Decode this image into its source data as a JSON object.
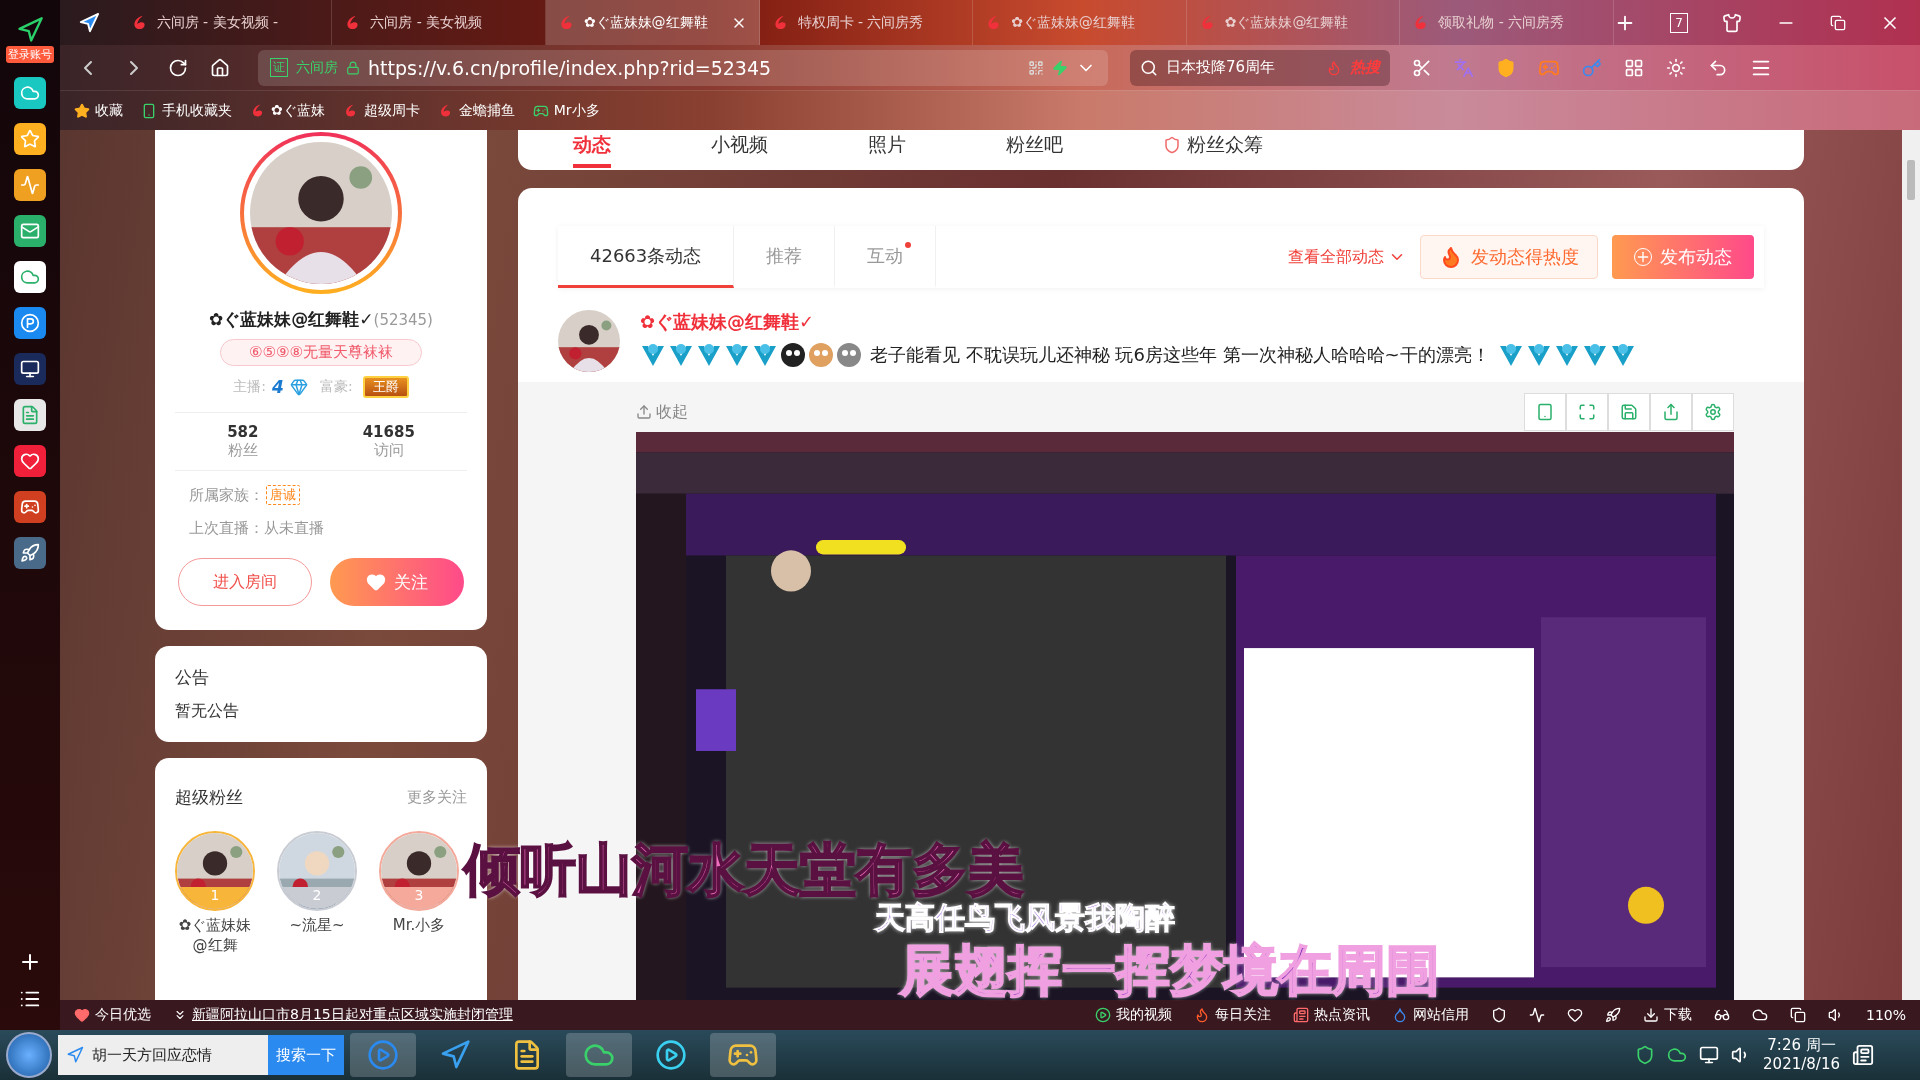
{
  "dock": {
    "login_badge": "登录账号"
  },
  "tabs": [
    {
      "title": "六间房 - 美女视频 -",
      "selected": false
    },
    {
      "title": "六间房 - 美女视频",
      "selected": false
    },
    {
      "title": "✿ぐ蓝妹妹@红舞鞋",
      "selected": true
    },
    {
      "title": "特权周卡 - 六间房秀",
      "selected": false
    },
    {
      "title": "✿ぐ蓝妹妹@红舞鞋",
      "selected": false
    },
    {
      "title": "✿ぐ蓝妹妹@红舞鞋",
      "selected": false
    },
    {
      "title": "领取礼物 - 六间房秀",
      "selected": false
    }
  ],
  "window_count": "7",
  "address": {
    "cert": "证",
    "site": "六间房",
    "url": "https://v.6.cn/profile/index.php?rid=52345"
  },
  "search": {
    "value": "日本投降76周年",
    "hot": "热搜"
  },
  "bookmarks": [
    {
      "kind": "star",
      "label": "收藏"
    },
    {
      "kind": "phone",
      "label": "手机收藏夹"
    },
    {
      "kind": "six",
      "label": "✿ぐ蓝妹"
    },
    {
      "kind": "six",
      "label": "超级周卡"
    },
    {
      "kind": "six",
      "label": "金蟾捕鱼"
    },
    {
      "kind": "app",
      "label": "Mr小多"
    }
  ],
  "nav_tabs": [
    {
      "label": "动态",
      "selected": true
    },
    {
      "label": "小视频",
      "selected": false
    },
    {
      "label": "照片",
      "selected": false
    },
    {
      "label": "粉丝吧",
      "selected": false
    },
    {
      "label": "粉丝众筹",
      "selected": false
    }
  ],
  "profile": {
    "name": "✿ぐ蓝妹妹@红舞鞋✓",
    "rid": "(52345)",
    "title_badge": "⑥⑤⑨⑧无量天尊袜袜",
    "anchor_label": "主播:",
    "anchor_level": "4",
    "rich_label": "富豪:",
    "rich_badge": "王爵",
    "stats": [
      {
        "value": "582",
        "label": "粉丝"
      },
      {
        "value": "41685",
        "label": "访问"
      }
    ],
    "family_label": "所属家族：",
    "family": "唐诚",
    "last_live": "上次直播：从未直播",
    "enter_button": "进入房间",
    "follow_button": "关注"
  },
  "notice": {
    "title": "公告",
    "text": "暂无公告"
  },
  "super_fans": {
    "title": "超级粉丝",
    "more": "更多关注",
    "fans": [
      {
        "name": "✿ぐ蓝妹妹@红舞",
        "rank": "1",
        "color": "#f7b53a"
      },
      {
        "name": "~流星~",
        "rank": "2",
        "color": "#c9ccd3"
      },
      {
        "name": "Mr.小多",
        "rank": "3",
        "color": "#f4a99a"
      }
    ]
  },
  "feed_tabs": [
    {
      "label": "42663条动态",
      "selected": true,
      "dot": false
    },
    {
      "label": "推荐",
      "selected": false,
      "dot": false
    },
    {
      "label": "互动",
      "selected": false,
      "dot": true
    }
  ],
  "feed_filter": "查看全部动态",
  "hot_button": "发动态得热度",
  "publish_button": "发布动态",
  "post": {
    "author": "✿ぐ蓝妹妹@红舞鞋✓",
    "text": "老子能看见 不耽误玩儿还神秘 玩6房这些年 第一次神秘人哈哈哈~干的漂亮！",
    "collapse": "收起"
  },
  "lyrics": [
    "倾听山河水天堂有多美",
    "天高任鸟飞风景我陶醉",
    "展翅挥一挥梦境在周围"
  ],
  "status_bar": {
    "today": "今日优选",
    "news": "新疆阿拉山口市8月15日起对重点区域实施封闭管理",
    "items": [
      {
        "kind": "video",
        "label": "我的视频"
      },
      {
        "kind": "flame",
        "label": "每日关注"
      },
      {
        "kind": "news",
        "label": "热点资讯"
      },
      {
        "kind": "drop",
        "label": "网站信用"
      }
    ],
    "download": "下载",
    "zoom": "110%"
  },
  "taskbar": {
    "search": "胡一天方回应恋情",
    "search_button": "搜索一下",
    "time": "7:26 周一",
    "date": "2021/8/16"
  }
}
